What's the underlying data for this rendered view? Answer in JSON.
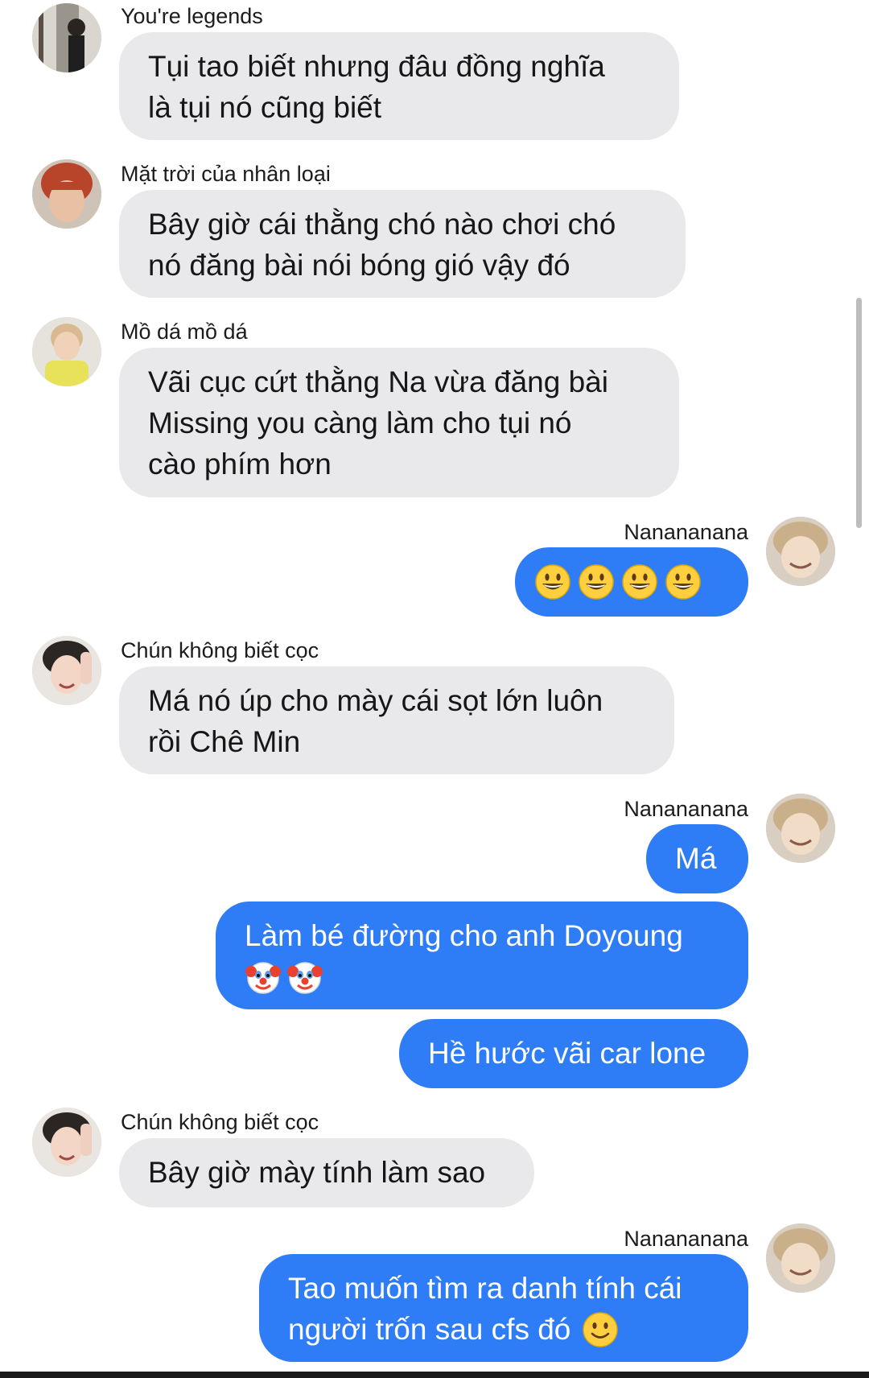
{
  "chat": {
    "messages": [
      {
        "sender": "You're legends",
        "lines": [
          "Tụi tao biết nhưng đâu đồng nghĩa",
          "là tụi nó cũng biết"
        ]
      },
      {
        "sender": "Mặt trời của nhân loại",
        "lines": [
          "Bây giờ cái thằng chó nào chơi chó",
          "nó đăng bài nói bóng gió vậy đó"
        ]
      },
      {
        "sender": "Mồ dá mồ dá",
        "lines": [
          "Vãi cục cứt thằng Na vừa đăng bài",
          "Missing you càng làm cho tụi nó",
          "cào phím hơn"
        ]
      },
      {
        "sender": "Nanananana",
        "emojis": [
          "grinning-face-icon",
          "grinning-face-icon",
          "grinning-face-icon",
          "grinning-face-icon"
        ]
      },
      {
        "sender": "Chún không biết cọc",
        "lines": [
          "Má nó úp cho mày cái sọt lớn luôn",
          "rồi Chê Min"
        ]
      },
      {
        "sender": "Nanananana",
        "lines": [
          "Má"
        ]
      },
      {
        "lines": [
          "Làm bé đường cho anh Doyoung"
        ],
        "emojis": [
          "clown-face-icon",
          "clown-face-icon"
        ]
      },
      {
        "lines": [
          "Hề hước vãi car lone"
        ]
      },
      {
        "sender": "Chún không biết cọc",
        "lines": [
          "Bây giờ mày tính làm sao"
        ]
      },
      {
        "sender": "Nanananana",
        "lines": [
          "Tao muốn tìm ra danh tính cái",
          "người trốn sau cfs đó"
        ],
        "emojis": [
          "slightly-smiling-face-icon"
        ]
      }
    ]
  },
  "colors": {
    "incoming_bubble": "#e9e9eb",
    "outgoing_bubble": "#2f7df6",
    "outgoing_text": "#ffffff"
  }
}
